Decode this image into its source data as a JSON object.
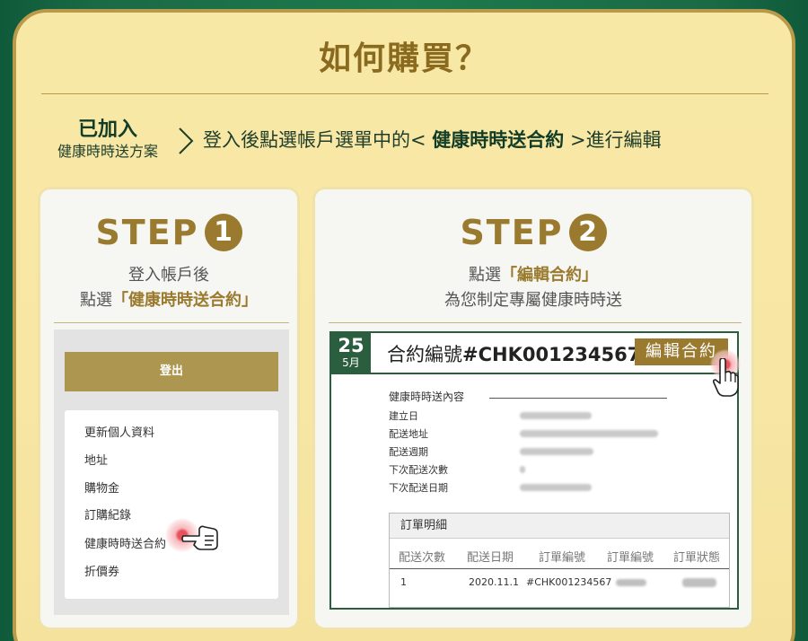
{
  "title": "如何購買？",
  "added": {
    "big": "已加入",
    "small": "健康時時送方案"
  },
  "instruction": {
    "before": "登入後點選帳戶選單中的< ",
    "bold": "健康時時送合約",
    "after": " >進行編輯"
  },
  "step1": {
    "label": "STEP",
    "num": "1",
    "desc_line1": "登入帳戶後",
    "desc_line2_pre": "點選",
    "desc_line2_bold": "「健康時時送合約」",
    "logout": "登出",
    "menu": [
      "更新個人資料",
      "地址",
      "購物金",
      "訂購紀錄",
      "健康時時送合約",
      "折價券"
    ]
  },
  "step2": {
    "label": "STEP",
    "num": "2",
    "desc_line1_pre": "點選",
    "desc_line1_bold": "「編輯合約」",
    "desc_line2": "為您制定專屬健康時時送",
    "date_day": "25",
    "date_month": "5月",
    "contract_no_prefix": "合約編號",
    "contract_no": "#CHK001234567",
    "edit_button": "編輯合約",
    "section_title": "健康時時送內容",
    "fields": [
      "建立日",
      "配送地址",
      "配送週期",
      "下次配送次數",
      "下次配送日期"
    ],
    "order_title": "訂單明細",
    "order_columns": [
      "配送次數",
      "配送日期",
      "訂單編號",
      "訂單編號",
      "訂單狀態"
    ],
    "order_row": {
      "count": "1",
      "date": "2020.11.1",
      "order_no": "#CHK001234567"
    }
  },
  "colors": {
    "gold": "#9a7a2e",
    "green": "#2a5e3e",
    "panel": "#f8e8a6"
  }
}
